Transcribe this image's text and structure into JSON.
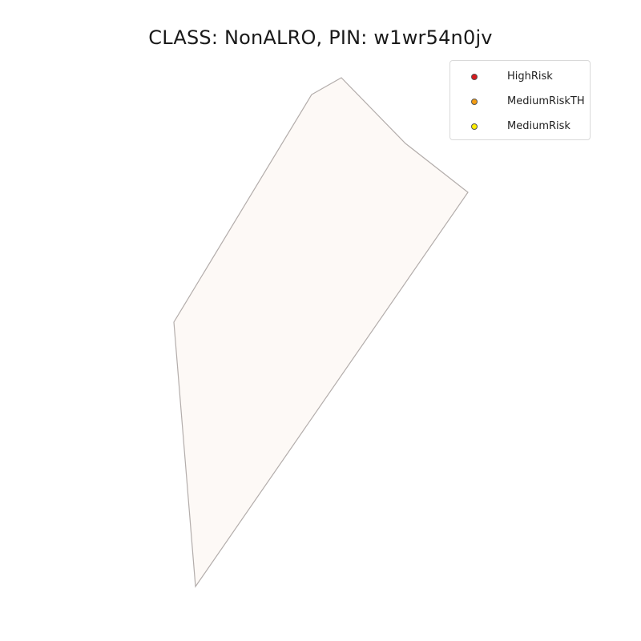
{
  "map": {
    "title": "CLASS: NonALRO, PIN: w1wr54n0jv",
    "parcel": {
      "fill_color": "#fdf9f6",
      "stroke_color": "#b3adab"
    }
  },
  "legend": {
    "items": [
      {
        "label": "HighRisk",
        "color": "#d7191c"
      },
      {
        "label": "MediumRiskTH",
        "color": "#f39c12"
      },
      {
        "label": "MediumRisk",
        "color": "#ffee00"
      }
    ]
  }
}
